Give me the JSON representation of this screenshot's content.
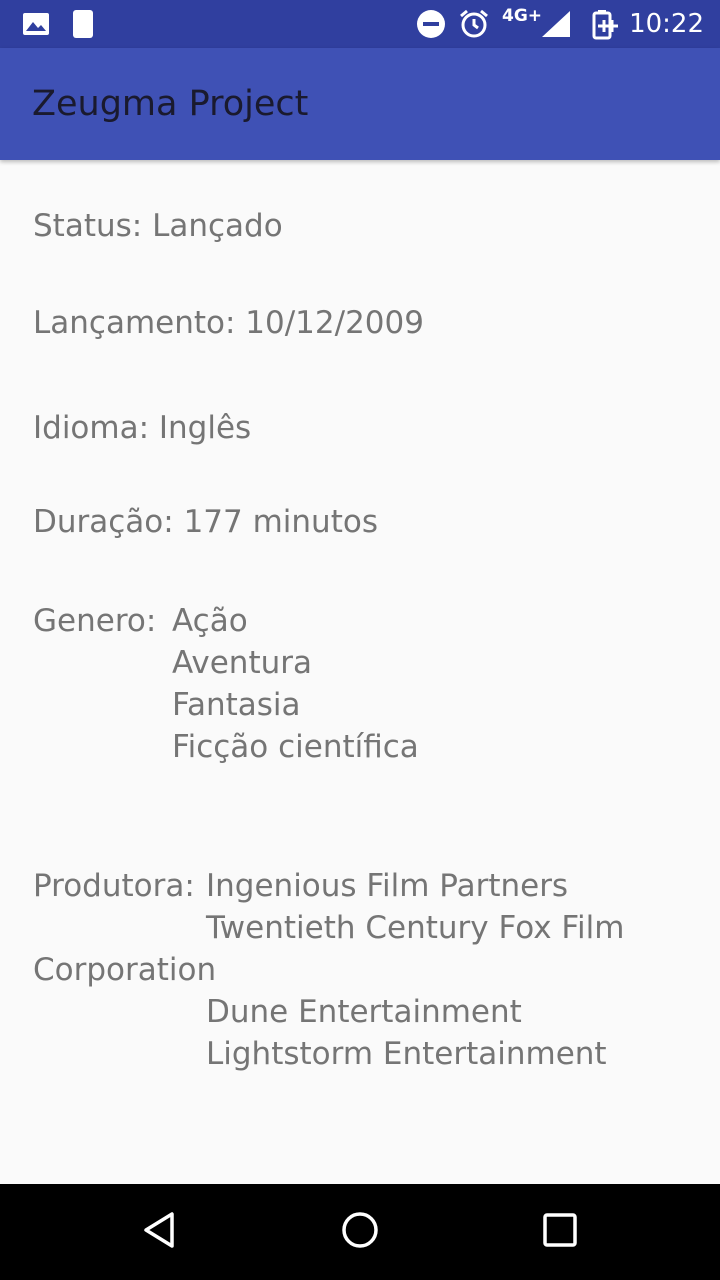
{
  "status_bar": {
    "time": "10:22",
    "network": "4G+",
    "icons": [
      "image-icon",
      "phone-icon",
      "do-not-disturb-icon",
      "alarm-icon",
      "signal-icon",
      "battery-charging-icon"
    ]
  },
  "app_bar": {
    "title": "Zeugma Project"
  },
  "details": {
    "status": "Status: Lançado",
    "release": "Lançamento: 10/12/2009",
    "language": "Idioma: Inglês",
    "duration": "Duração: 177 minutos",
    "genre_label": "Genero:",
    "genres": [
      "Ação",
      "Aventura",
      "Fantasia",
      "Ficção científica"
    ],
    "producer_label": "Produtora:",
    "producers_line1": "Ingenious Film Partners",
    "producers_line2": "Twentieth Century Fox Film",
    "producers_line3": "Corporation",
    "producers_line4": "Dune Entertainment",
    "producers_line5": "Lightstorm Entertainment"
  },
  "nav_bar": {
    "buttons": [
      "back-icon",
      "home-icon",
      "recents-icon"
    ]
  },
  "colors": {
    "status_bar": "#303f9f",
    "app_bar": "#3f51b5",
    "background": "#fafafa",
    "text": "#757575"
  }
}
